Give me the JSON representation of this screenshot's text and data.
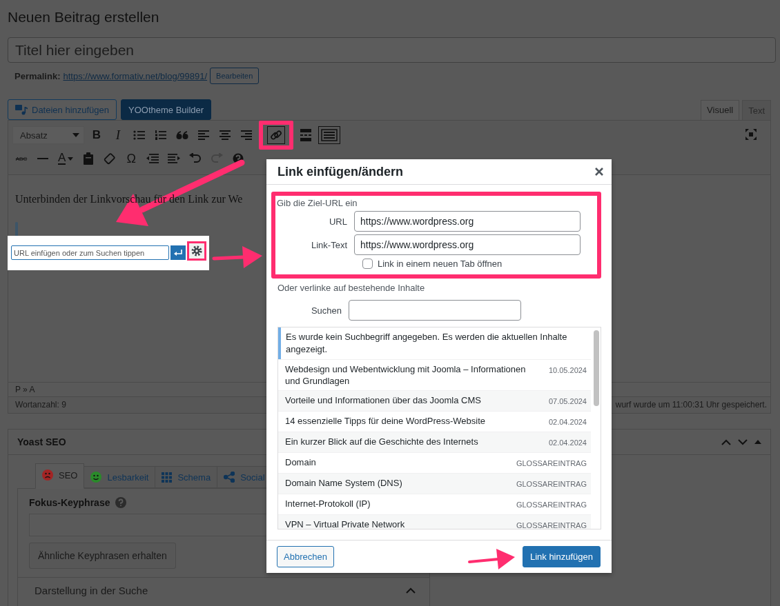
{
  "page_title": "Neuen Beitrag erstellen",
  "title_field": {
    "placeholder": "Titel hier eingeben"
  },
  "permalink": {
    "label": "Permalink:",
    "url": "https://www.formativ.net/blog/99891/",
    "edit_button": "Bearbeiten"
  },
  "media_buttons": [
    {
      "kind": "media",
      "label": "Dateien hinzufügen"
    },
    {
      "kind": "builder",
      "label": "YOOtheme Builder"
    }
  ],
  "editor_tabs": [
    {
      "label": "Visuell",
      "selected": true
    },
    {
      "label": "Text",
      "selected": false
    }
  ],
  "toolbar": {
    "rows": [
      [
        {
          "kind": "format-select",
          "label": "Absatz"
        },
        {
          "kind": "bold",
          "text": "B",
          "active": false
        },
        {
          "kind": "italic",
          "text": "I",
          "active": false
        },
        {
          "kind": "bulleted-list",
          "active": false
        },
        {
          "kind": "numbered-list",
          "active": false
        },
        {
          "kind": "blockquote",
          "active": false
        },
        {
          "kind": "align-left",
          "active": false
        },
        {
          "kind": "align-center",
          "active": false
        },
        {
          "kind": "align-right",
          "active": false
        },
        {
          "kind": "insert-link",
          "active": true
        },
        {
          "kind": "read-more",
          "active": false
        },
        {
          "kind": "toolbar-toggle",
          "active": true
        }
      ],
      [
        {
          "kind": "strikethrough",
          "text": "ABC",
          "active": false
        },
        {
          "kind": "horizontal-line",
          "active": false
        },
        {
          "kind": "text-color",
          "text": "A",
          "active": false
        },
        {
          "kind": "paste-as-text",
          "active": false
        },
        {
          "kind": "clear-formatting",
          "active": false
        },
        {
          "kind": "special-character",
          "text": "Ω",
          "active": false
        },
        {
          "kind": "outdent",
          "active": false
        },
        {
          "kind": "indent",
          "active": false
        },
        {
          "kind": "undo",
          "active": false
        },
        {
          "kind": "redo",
          "active": false
        },
        {
          "kind": "help",
          "active": false
        }
      ]
    ]
  },
  "content": {
    "paragraph": "Unterbinden der Linkvorschau für den Link zur We"
  },
  "path": "P » A",
  "word_count": "Wortanzahl: 9",
  "autosave": "wurf wurde um 11:00:31 Uhr gespeichert.",
  "link_popup": {
    "placeholder": "URL einfügen oder zum Suchen tippen"
  },
  "yoast": {
    "title": "Yoast SEO",
    "tabs": [
      {
        "kind": "face",
        "label": "SEO",
        "selected": true,
        "color": "#a32424"
      },
      {
        "kind": "face",
        "label": "Lesbarkeit",
        "selected": false,
        "color": "#2a8a2a"
      },
      {
        "kind": "grid",
        "label": "Schema",
        "selected": false
      },
      {
        "kind": "share",
        "label": "Social",
        "selected": false
      }
    ],
    "focus_label": "Fokus-Keyphrase",
    "related_button": "Ähnliche Keyphrasen erhalten",
    "section": "Darstellung in der Suche",
    "section_expanded": true
  },
  "dialog": {
    "title": "Link einfügen/ändern",
    "intro": "Gib die Ziel-URL ein",
    "fields": [
      {
        "label": "URL",
        "value": "https://www.wordpress.org"
      },
      {
        "label": "Link-Text",
        "value": "https://www.wordpress.org"
      }
    ],
    "new_tab": {
      "label": "Link in einem neuen Tab öffnen",
      "checked": false
    },
    "search_intro": "Oder verlinke auf bestehende Inhalte",
    "search_label": "Suchen",
    "notice": "Es wurde kein Suchbegriff angegeben. Es werden die aktuellen Inhalte angezeigt.",
    "results": [
      {
        "title": "Webdesign und Webentwicklung mit Joomla – Informationen und Grundlagen",
        "meta": "10.05.2024"
      },
      {
        "title": "Vorteile und Informationen über das Joomla CMS",
        "meta": "07.05.2024"
      },
      {
        "title": "14 essenzielle Tipps für deine WordPress-Website",
        "meta": "02.04.2024"
      },
      {
        "title": "Ein kurzer Blick auf die Geschichte des Internets",
        "meta": "02.04.2024"
      },
      {
        "title": "Domain",
        "meta": "GLOSSAREINTRAG"
      },
      {
        "title": "Domain Name System (DNS)",
        "meta": "GLOSSAREINTRAG"
      },
      {
        "title": "Internet-Protokoll (IP)",
        "meta": "GLOSSAREINTRAG"
      },
      {
        "title": "VPN – Virtual Private Network",
        "meta": "GLOSSAREINTRAG"
      }
    ],
    "cancel": "Abbrechen",
    "submit": "Link hinzufügen"
  }
}
